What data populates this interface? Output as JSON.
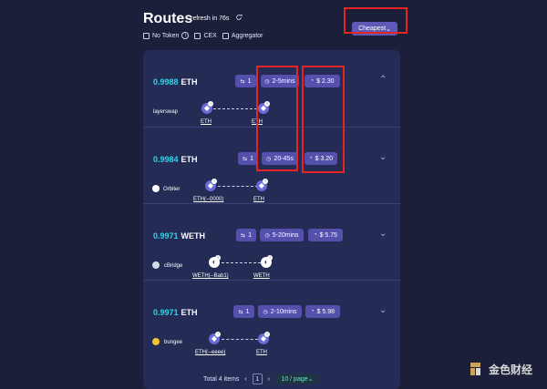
{
  "header": {
    "title": "Routes",
    "refresh_text": "refresh in 76s",
    "sort_label": "Cheapest",
    "filters": [
      "No Token",
      "CEX",
      "Aggregator"
    ]
  },
  "routes": [
    {
      "value": "0.9988",
      "token": "ETH",
      "chips": [
        {
          "icon": "steps-icon",
          "text": "1"
        },
        {
          "icon": "clock-icon",
          "text": "2-5mins"
        },
        {
          "icon": "dollar-icon",
          "text": "$ 2.30"
        }
      ],
      "provider": "layerswap",
      "labels": [
        "ETH",
        "ETH"
      ]
    },
    {
      "value": "0.9984",
      "token": "ETH",
      "chips": [
        {
          "icon": "steps-icon",
          "text": "1"
        },
        {
          "icon": "clock-icon",
          "text": "20-45s"
        },
        {
          "icon": "dollar-icon",
          "text": "$ 3.20"
        }
      ],
      "provider": "Orbiter",
      "labels": [
        "ETH(--0000)",
        "ETH"
      ]
    },
    {
      "value": "0.9971",
      "token": "WETH",
      "chips": [
        {
          "icon": "steps-icon",
          "text": "1"
        },
        {
          "icon": "clock-icon",
          "text": "5-20mins"
        },
        {
          "icon": "dollar-icon",
          "text": "$ 5.75"
        }
      ],
      "provider": "cBridge",
      "labels": [
        "WETH(--Bab1)",
        "WETH"
      ]
    },
    {
      "value": "0.9971",
      "token": "ETH",
      "chips": [
        {
          "icon": "steps-icon",
          "text": "1"
        },
        {
          "icon": "clock-icon",
          "text": "2-10mins"
        },
        {
          "icon": "dollar-icon",
          "text": "$ 5.98"
        }
      ],
      "provider": "bungee",
      "labels": [
        "ETH(--eeee)",
        "ETH"
      ]
    }
  ],
  "pagination": {
    "total": "Total 4 items",
    "page": "1",
    "page_size": "10 / page"
  },
  "watermark": "金色财经",
  "colors": {
    "accent": "#5e5bb8",
    "value": "#29d7e8",
    "highlight": "#e52424"
  }
}
